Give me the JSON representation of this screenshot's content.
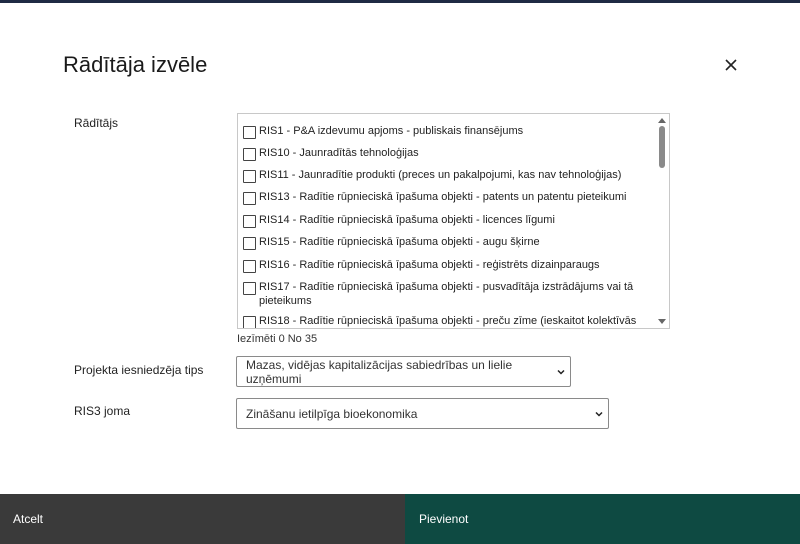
{
  "modal": {
    "title": "Rādītāja izvēle",
    "close_icon": "close-icon"
  },
  "indicator": {
    "label": "Rādītājs",
    "items": [
      {
        "label": "RIS1 - P&A izdevumu apjoms - publiskais finansējums",
        "checked": false
      },
      {
        "label": "RIS10 - Jaunradītās tehnoloģijas",
        "checked": false
      },
      {
        "label": "RIS11 - Jaunradītie produkti (preces un pakalpojumi, kas nav tehnoloģijas)",
        "checked": false
      },
      {
        "label": "RIS13 - Radītie rūpnieciskā īpašuma objekti - patents un  patentu pieteikumi",
        "checked": false
      },
      {
        "label": "RIS14 - Radītie rūpnieciskā īpašuma objekti - licences līgumi",
        "checked": false
      },
      {
        "label": "RIS15 - Radītie rūpnieciskā īpašuma objekti - augu šķirne",
        "checked": false
      },
      {
        "label": "RIS16 - Radītie rūpnieciskā īpašuma objekti - reģistrēts dizainparaugs",
        "checked": false
      },
      {
        "label": "RIS17 - Radītie rūpnieciskā īpašuma objekti - pusvadītāja izstrādājums  vai tā pieteikums",
        "checked": false
      },
      {
        "label": "RIS18 - Radītie rūpnieciskā īpašuma objekti - preču zīme (ieskaitot kolektīvās",
        "checked": false
      }
    ],
    "counter": "Iezīmēti 0 No 35"
  },
  "applicant_type": {
    "label": "Projekta iesniedzēja tips",
    "selected": "Mazas, vidējas kapitalizācijas sabiedrības un lielie uzņēmumi"
  },
  "ris3": {
    "label": "RIS3 joma",
    "selected": "Zināšanu ietilpīga bioekonomika"
  },
  "footer": {
    "cancel_label": "Atcelt",
    "add_label": "Pievienot"
  }
}
